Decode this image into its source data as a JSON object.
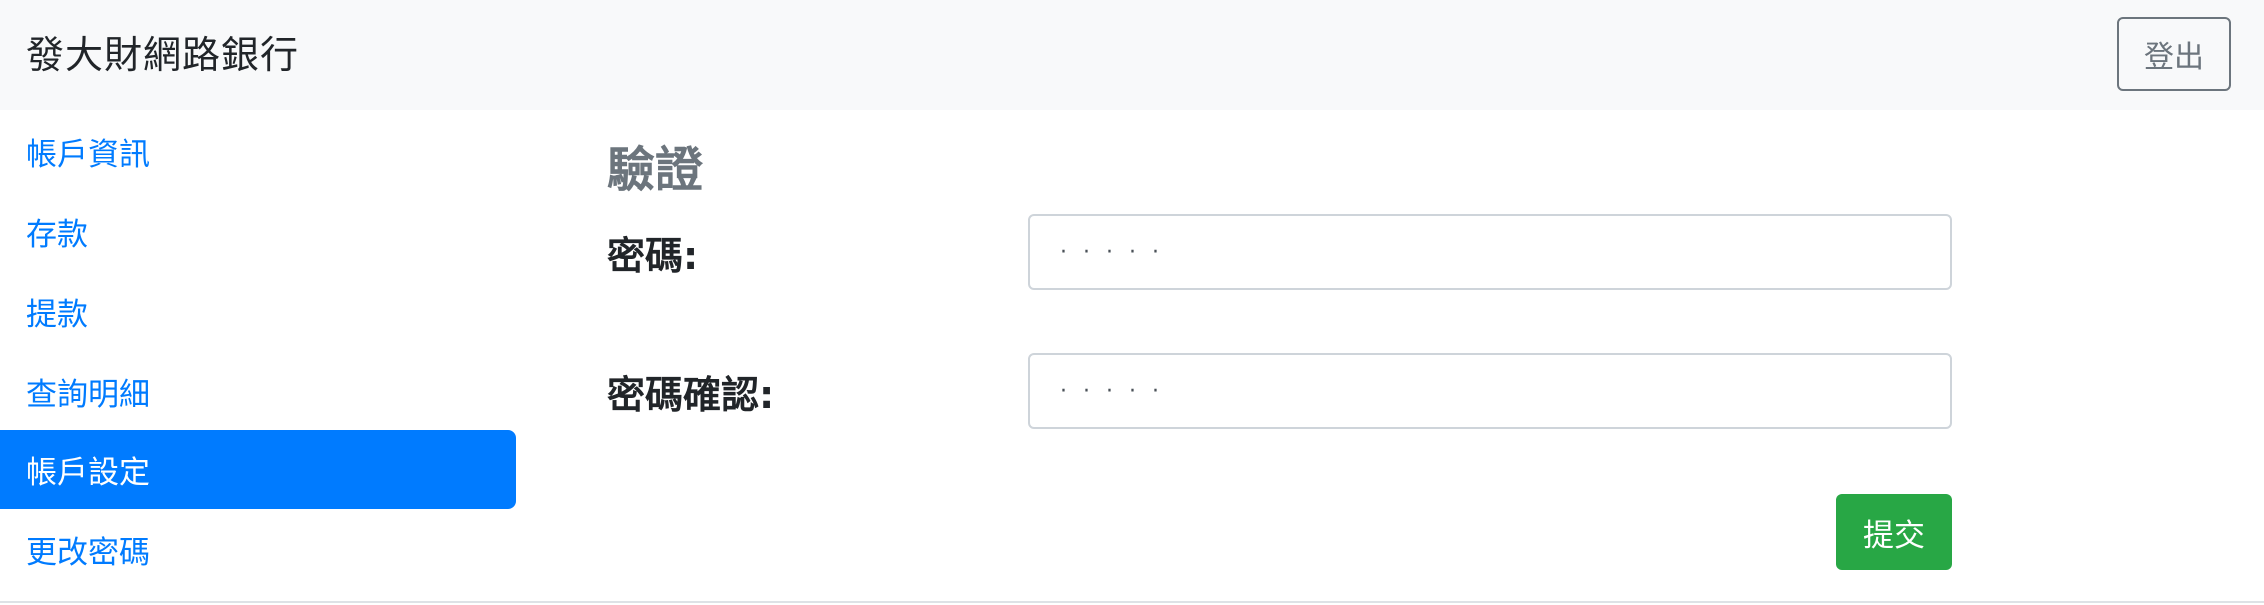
{
  "navbar": {
    "brand": "發大財網路銀行",
    "logout_label": "登出"
  },
  "sidebar": {
    "items": [
      {
        "label": "帳戶資訊",
        "active": false
      },
      {
        "label": "存款",
        "active": false
      },
      {
        "label": "提款",
        "active": false
      },
      {
        "label": "查詢明細",
        "active": false
      },
      {
        "label": "帳戶設定",
        "active": true
      },
      {
        "label": "更改密碼",
        "active": false
      }
    ]
  },
  "form": {
    "title": "驗證",
    "password_label": "密碼:",
    "password_value": "·····",
    "confirm_label": "密碼確認:",
    "confirm_value": "·····",
    "submit_label": "提交"
  },
  "colors": {
    "primary": "#007bff",
    "success": "#28a745",
    "secondary": "#6c757d",
    "navbar_bg": "#f8f9fa"
  }
}
